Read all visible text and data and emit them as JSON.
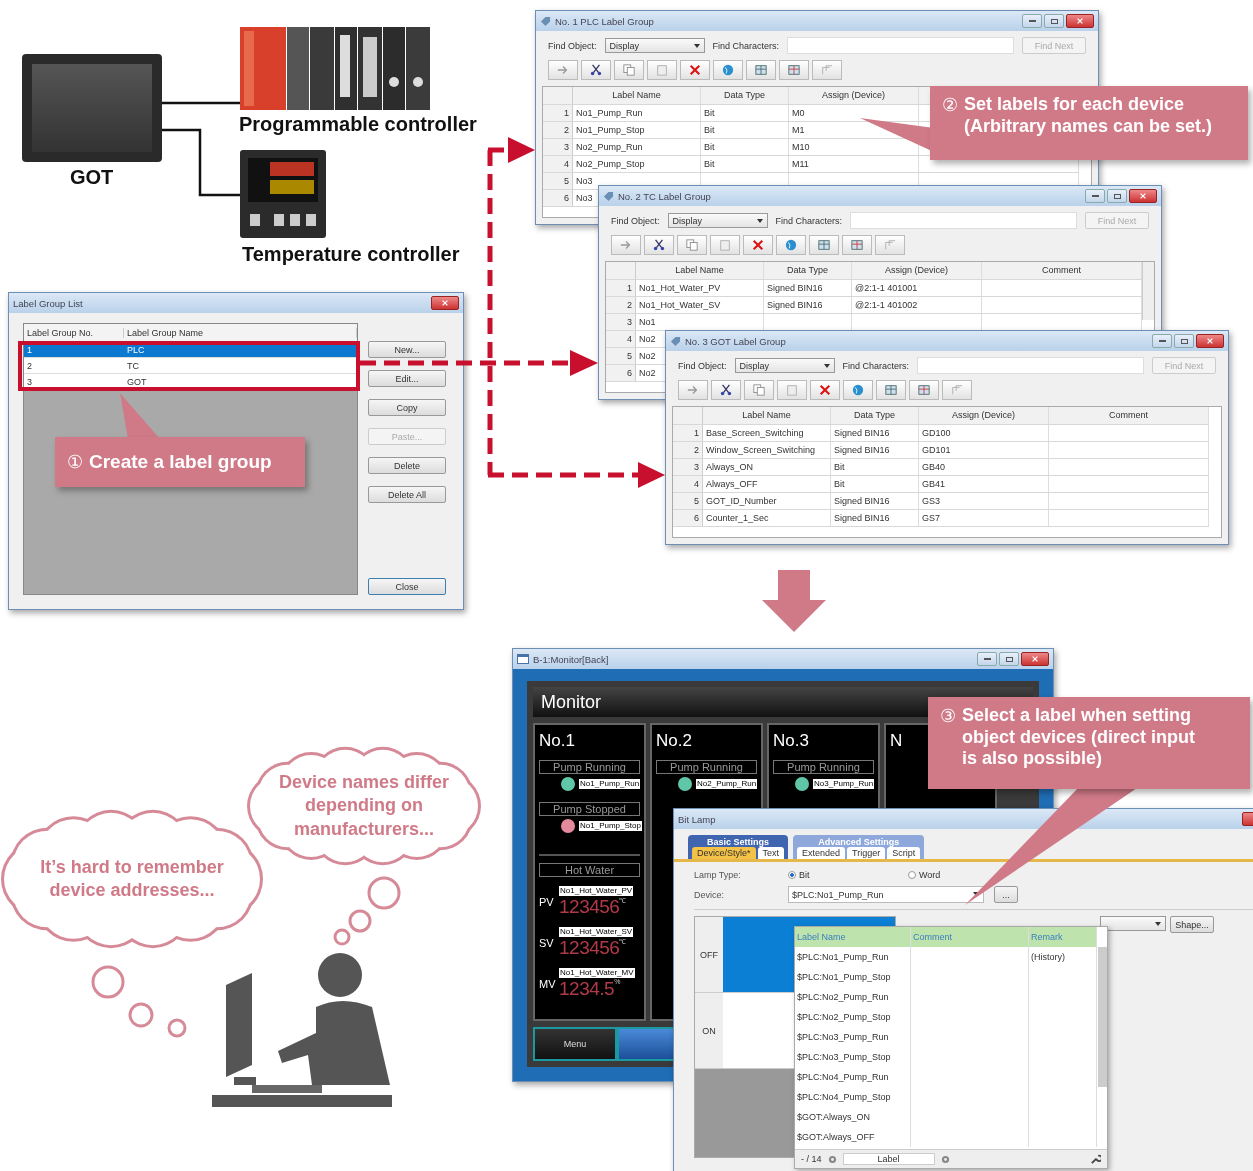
{
  "devices": [
    {
      "kind": "got",
      "label": "GOT"
    },
    {
      "kind": "plc",
      "label": "Programmable controller"
    },
    {
      "kind": "temperature",
      "label": "Temperature controller"
    }
  ],
  "label_group_list": {
    "title": "Label Group List",
    "columns": [
      "Label Group No.",
      "Label Group Name"
    ],
    "rows": [
      {
        "number": "1",
        "name": "PLC",
        "selected": true
      },
      {
        "number": "2",
        "name": "TC",
        "selected": false
      },
      {
        "number": "3",
        "name": "GOT",
        "selected": false
      }
    ],
    "buttons": [
      {
        "label": "New...",
        "disabled": false
      },
      {
        "label": "Edit...",
        "disabled": false
      },
      {
        "label": "Copy",
        "disabled": false
      },
      {
        "label": "Paste...",
        "disabled": true
      },
      {
        "label": "Delete",
        "disabled": false
      },
      {
        "label": "Delete All",
        "disabled": false
      }
    ],
    "close_button": "Close"
  },
  "label_windows": [
    {
      "title": "No. 1 PLC Label Group",
      "find_object_label": "Find Object:",
      "find_object_value": "Display",
      "find_characters_label": "Find Characters:",
      "find_next": "Find Next",
      "columns": [
        "Label Name",
        "Data Type",
        "Assign (Device)"
      ],
      "rows": [
        {
          "number": "1",
          "cells": [
            "No1_Pump_Run",
            "Bit",
            "M0"
          ]
        },
        {
          "number": "2",
          "cells": [
            "No1_Pump_Stop",
            "Bit",
            "M1"
          ]
        },
        {
          "number": "3",
          "cells": [
            "No2_Pump_Run",
            "Bit",
            "M10"
          ]
        },
        {
          "number": "4",
          "cells": [
            "No2_Pump_Stop",
            "Bit",
            "M11"
          ]
        },
        {
          "number": "5",
          "cells": [
            "No3"
          ]
        },
        {
          "number": "6",
          "cells": [
            "No3"
          ]
        }
      ]
    },
    {
      "title": "No. 2 TC Label Group",
      "find_object_label": "Find Object:",
      "find_object_value": "Display",
      "find_characters_label": "Find Characters:",
      "find_next": "Find Next",
      "columns": [
        "Label Name",
        "Data Type",
        "Assign (Device)",
        "Comment"
      ],
      "rows": [
        {
          "number": "1",
          "cells": [
            "No1_Hot_Water_PV",
            "Signed BIN16",
            "@2:1-1 401001"
          ]
        },
        {
          "number": "2",
          "cells": [
            "No1_Hot_Water_SV",
            "Signed BIN16",
            "@2:1-1 401002"
          ]
        },
        {
          "number": "3",
          "cells": [
            "No1"
          ]
        },
        {
          "number": "4",
          "cells": [
            "No2"
          ]
        },
        {
          "number": "5",
          "cells": [
            "No2"
          ]
        },
        {
          "number": "6",
          "cells": [
            "No2"
          ]
        }
      ]
    },
    {
      "title": "No. 3 GOT Label Group",
      "find_object_label": "Find Object:",
      "find_object_value": "Display",
      "find_characters_label": "Find Characters:",
      "find_next": "Find Next",
      "columns": [
        "Label Name",
        "Data Type",
        "Assign (Device)",
        "Comment"
      ],
      "rows": [
        {
          "number": "1",
          "cells": [
            "Base_Screen_Switching",
            "Signed BIN16",
            "GD100"
          ]
        },
        {
          "number": "2",
          "cells": [
            "Window_Screen_Switching",
            "Signed BIN16",
            "GD101"
          ]
        },
        {
          "number": "3",
          "cells": [
            "Always_ON",
            "Bit",
            "GB40"
          ]
        },
        {
          "number": "4",
          "cells": [
            "Always_OFF",
            "Bit",
            "GB41"
          ]
        },
        {
          "number": "5",
          "cells": [
            "GOT_ID_Number",
            "Signed BIN16",
            "GS3"
          ]
        },
        {
          "number": "6",
          "cells": [
            "Counter_1_Sec",
            "Signed BIN16",
            "GS7"
          ]
        }
      ]
    }
  ],
  "callouts": [
    {
      "number": "①",
      "lines": [
        "Create a label group"
      ]
    },
    {
      "number": "②",
      "lines": [
        "Set labels for each device",
        "(Arbitrary names can be set.)"
      ]
    },
    {
      "number": "③",
      "lines": [
        "Select a label when setting",
        "object devices (direct input",
        "is also possible)"
      ]
    }
  ],
  "monitor": {
    "title": "B-1:Monitor[Back]",
    "header": "Monitor",
    "panels": [
      {
        "title": "No.1",
        "items": [
          {
            "kind": "status",
            "caption": "Pump Running",
            "tag": "No1_Pump_Run",
            "color": "#5fc7a8"
          },
          {
            "kind": "status",
            "caption": "Pump Stopped",
            "tag": "No1_Pump_Stop",
            "color": "#e48a9c"
          },
          {
            "kind": "section",
            "caption": "Hot Water"
          },
          {
            "kind": "reading",
            "name": "PV",
            "tag": "No1_Hot_Water_PV",
            "value": "123456",
            "unit": "℃"
          },
          {
            "kind": "reading",
            "name": "SV",
            "tag": "No1_Hot_Water_SV",
            "value": "123456",
            "unit": "℃"
          },
          {
            "kind": "reading",
            "name": "MV",
            "tag": "No1_Hot_Water_MV",
            "value": "1234.5",
            "unit": "%"
          }
        ]
      },
      {
        "title": "No.2",
        "items": [
          {
            "kind": "status",
            "caption": "Pump Running",
            "tag": "No2_Pump_Run",
            "color": "#5fc7a8"
          }
        ]
      },
      {
        "title": "No.3",
        "items": [
          {
            "kind": "status",
            "caption": "Pump Running",
            "tag": "No3_Pump_Run",
            "color": "#5fc7a8"
          }
        ]
      },
      {
        "title": "N"
      }
    ],
    "footer_buttons": [
      "Menu"
    ]
  },
  "bit_lamp": {
    "title": "Bit Lamp",
    "tab_groups": [
      {
        "label": "Basic Settings",
        "tabs": [
          {
            "label": "Device/Style*",
            "selected": true
          },
          {
            "label": "Text",
            "selected": false
          }
        ]
      },
      {
        "label": "Advanced Settings",
        "tabs": [
          {
            "label": "Extended",
            "selected": false
          },
          {
            "label": "Trigger",
            "selected": false
          },
          {
            "label": "Script",
            "selected": false
          }
        ]
      }
    ],
    "lamp_type_label": "Lamp Type:",
    "lamp_types": [
      {
        "label": "Bit",
        "selected": true
      },
      {
        "label": "Word",
        "selected": false
      }
    ],
    "device_label": "Device:",
    "device_value": "$PLC:No1_Pump_Run",
    "browse_button": "...",
    "states": [
      "OFF",
      "ON"
    ],
    "shape_button": "Shape...",
    "dropdown": {
      "columns": [
        "Label Name",
        "Comment",
        "Remark"
      ],
      "rows": [
        {
          "label": "$PLC:No1_Pump_Run",
          "remark": "(History)"
        },
        {
          "label": "$PLC:No1_Pump_Stop"
        },
        {
          "label": "$PLC:No2_Pump_Run"
        },
        {
          "label": "$PLC:No2_Pump_Stop"
        },
        {
          "label": "$PLC:No3_Pump_Run"
        },
        {
          "label": "$PLC:No3_Pump_Stop"
        },
        {
          "label": "$PLC:No4_Pump_Run"
        },
        {
          "label": "$PLC:No4_Pump_Stop"
        },
        {
          "label": "$GOT:Always_ON"
        },
        {
          "label": "$GOT:Always_OFF"
        }
      ],
      "count": "- / 14",
      "footer_tab": "Label"
    }
  },
  "thoughts": [
    {
      "text": "Device names differ depending on manufacturers..."
    },
    {
      "text": "It’s hard to remember device addresses..."
    }
  ]
}
